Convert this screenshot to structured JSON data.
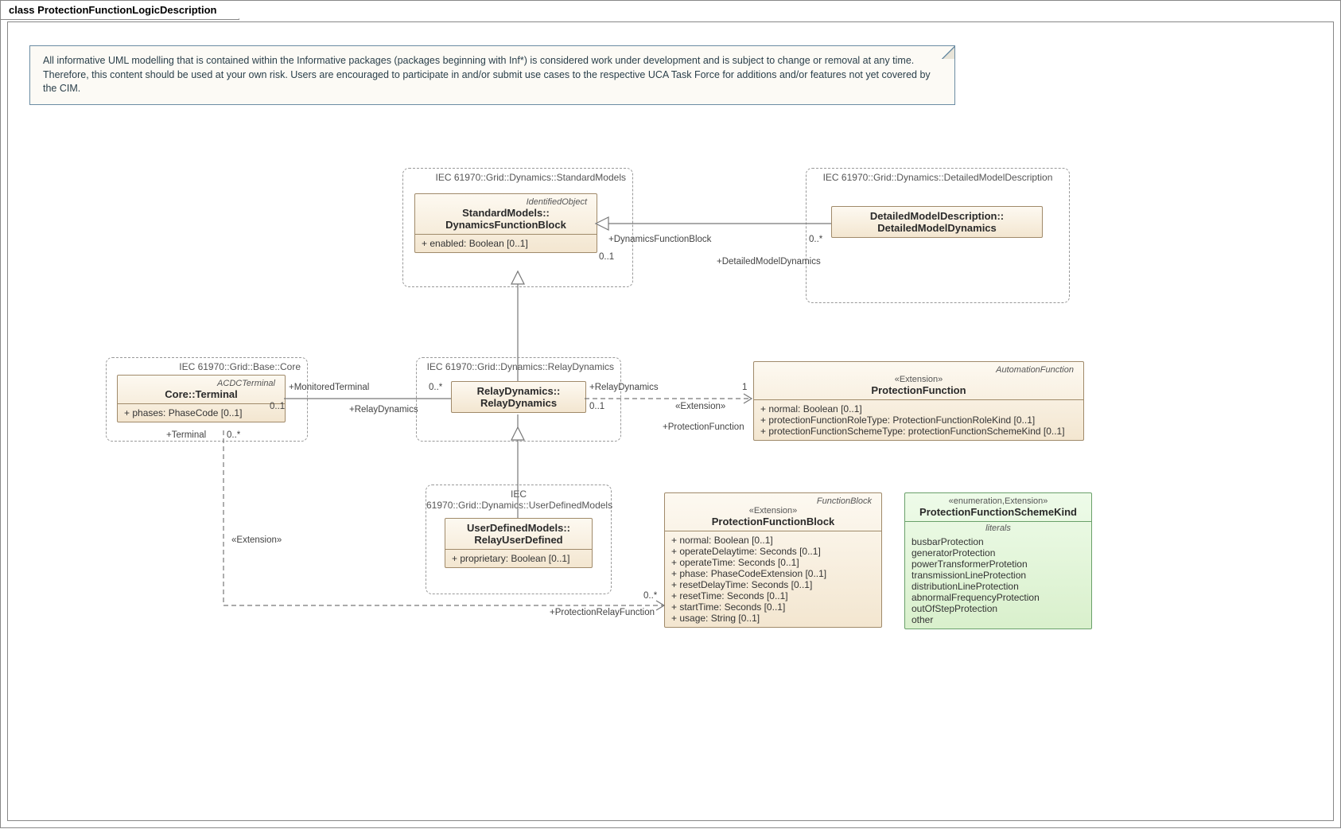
{
  "diagram": {
    "title": "class ProtectionFunctionLogicDescription"
  },
  "note": {
    "text": "All informative UML modelling that is contained within the Informative packages (packages beginning with Inf*) is considered work under development and is subject to change or removal at any time.  Therefore, this content should be used at your own risk. Users are encouraged to participate in and/or submit use cases to the respective UCA Task Force for additions and/or features not yet covered by the CIM."
  },
  "packages": {
    "std": "IEC 61970::Grid::Dynamics::StandardModels",
    "dmd": "IEC 61970::Grid::Dynamics::DetailedModelDescription",
    "core": "IEC 61970::Grid::Base::Core",
    "relay": "IEC 61970::Grid::Dynamics::RelayDynamics",
    "udm": "IEC 61970::Grid::Dynamics::UserDefinedModels"
  },
  "classes": {
    "dfb": {
      "parentStereo": "IdentifiedObject",
      "name": "StandardModels::DynamicsFunctionBlock",
      "name_l1": "StandardModels::",
      "name_l2": "DynamicsFunctionBlock",
      "attrs": [
        "+   enabled: Boolean [0..1]"
      ]
    },
    "dmd": {
      "name_l1": "DetailedModelDescription::",
      "name_l2": "DetailedModelDynamics"
    },
    "terminal": {
      "parentStereo": "ACDCTerminal",
      "name": "Core::Terminal",
      "attrs": [
        "+   phases: PhaseCode [0..1]"
      ]
    },
    "relay": {
      "name_l1": "RelayDynamics::",
      "name_l2": "RelayDynamics"
    },
    "rud": {
      "name_l1": "UserDefinedModels::",
      "name_l2": "RelayUserDefined",
      "attrs": [
        "+   proprietary: Boolean [0..1]"
      ]
    },
    "pf": {
      "parentStereo": "AutomationFunction",
      "stereo": "«Extension»",
      "name": "ProtectionFunction",
      "attrs": [
        "+   normal: Boolean [0..1]",
        "+   protectionFunctionRoleType: ProtectionFunctionRoleKind [0..1]",
        "+   protectionFunctionSchemeType: protectionFunctionSchemeKind [0..1]"
      ]
    },
    "pfb": {
      "parentStereo": "FunctionBlock",
      "stereo": "«Extension»",
      "name": "ProtectionFunctionBlock",
      "attrs": [
        "+   normal: Boolean [0..1]",
        "+   operateDelaytime: Seconds [0..1]",
        "+   operateTime: Seconds [0..1]",
        "+   phase: PhaseCodeExtension [0..1]",
        "+   resetDelayTime: Seconds [0..1]",
        "+   resetTime: Seconds [0..1]",
        "+   startTime: Seconds [0..1]",
        "+   usage: String [0..1]"
      ]
    },
    "enum": {
      "stereo": "«enumeration,Extension»",
      "name": "ProtectionFunctionSchemeKind",
      "section": "literals",
      "literals": [
        "busbarProtection",
        "generatorProtection",
        "powerTransformerProtetion",
        "transmissionLineProtection",
        "distributionLineProtection",
        "abnormalFrequencyProtection",
        "outOfStepProtection",
        "other"
      ]
    }
  },
  "assoc": {
    "dfb_dmd": {
      "role_l": "+DynamicsFunctionBlock",
      "mult_l": "0..1",
      "role_r": "+DetailedModelDynamics",
      "mult_r": "0..*"
    },
    "term_relay": {
      "role_l": "+MonitoredTerminal",
      "mult_l": "0..1",
      "role_r": "+RelayDynamics",
      "mult_r": "0..*"
    },
    "relay_pf": {
      "role_l": "+RelayDynamics",
      "mult_l": "0..1",
      "role_r": "+ProtectionFunction",
      "mult_r": "1",
      "stereo": "«Extension»"
    },
    "term_pfb": {
      "role_l": "+Terminal",
      "mult_l": "0..*",
      "role_r": "+ProtectionRelayFunction",
      "mult_r": "0..*",
      "stereo": "«Extension»"
    }
  }
}
